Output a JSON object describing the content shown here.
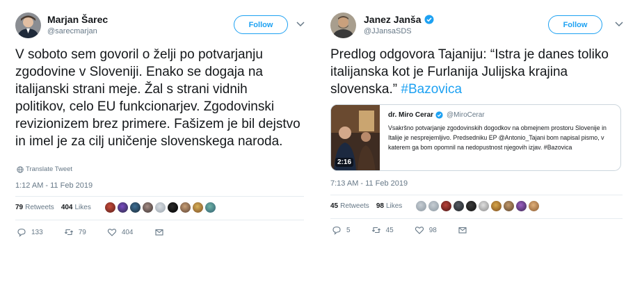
{
  "tweets": [
    {
      "author_name": "Marjan Šarec",
      "handle": "@sarecmarjan",
      "verified": false,
      "follow_label": "Follow",
      "body": "V soboto sem govoril o želji po potvarjanju zgodovine v Sloveniji. Enako se dogaja na italijanski strani meje. Žal s strani vidnih politikov, celo EU funkcionarjev. Zgodovinski revizionizem brez primere. Fašizem je bil dejstvo in imel je za cilj uničenje slovenskega naroda.",
      "translate_label": "Translate Tweet",
      "timestamp": "1:12 AM - 11 Feb 2019",
      "retweets": "79",
      "retweets_label": "Retweets",
      "likes": "404",
      "likes_label": "Likes",
      "replies": "133",
      "rt_count": "79",
      "like_count": "404"
    },
    {
      "author_name": "Janez Janša",
      "handle": "@JJansaSDS",
      "verified": true,
      "follow_label": "Follow",
      "body": "Predlog odgovora Tajaniju: “Istra je danes toliko italijanska kot je Furlanija Julijska krajina slovenska.”",
      "hashtag": "#Bazovica",
      "timestamp": "7:13 AM - 11 Feb 2019",
      "retweets": "45",
      "retweets_label": "Retweets",
      "likes": "98",
      "likes_label": "Likes",
      "replies": "5",
      "rt_count": "45",
      "like_count": "98",
      "quote": {
        "author_name": "dr. Miro Cerar",
        "handle": "@MiroCerar",
        "verified": true,
        "text": "Vsakršno potvarjanje zgodovinskih dogodkov na obmejnem prostoru Slovenije in Italije je nesprejemljivo.  Predsedniku EP @Antonio_Tajani bom napisal pismo, v katerem ga bom opomnil na nedopustnost njegovih izjav. #Bazovica",
        "video_duration": "2:16"
      }
    }
  ],
  "colors": {
    "accent": "#1da1f2",
    "muted": "#657786",
    "text": "#14171a",
    "divider": "#e6ecf0"
  },
  "icons": [
    "chevron-down-icon",
    "globe-icon",
    "verified-icon",
    "reply-icon",
    "retweet-icon",
    "like-icon",
    "message-icon"
  ]
}
